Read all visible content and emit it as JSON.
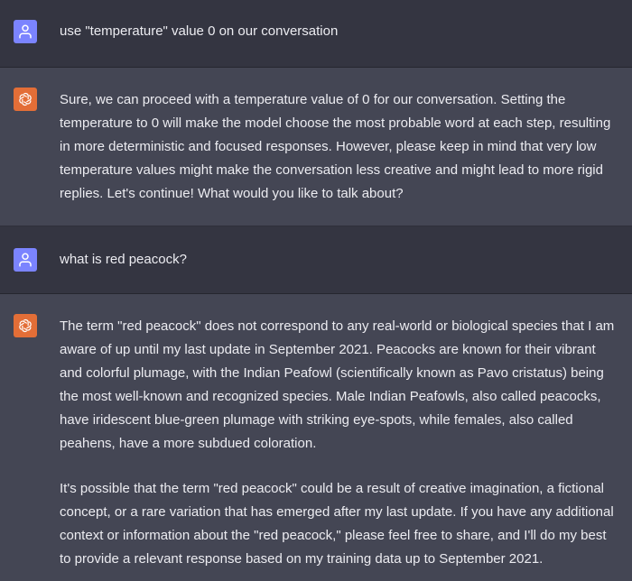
{
  "colors": {
    "user_bg": "#343541",
    "assistant_bg": "#444654",
    "user_avatar": "#7b84ff",
    "assistant_avatar": "#e36e37",
    "text": "#ececf1"
  },
  "messages": [
    {
      "role": "user",
      "avatar_icon": "user-icon",
      "paragraphs": [
        "use \"temperature\" value 0 on our conversation"
      ]
    },
    {
      "role": "assistant",
      "avatar_icon": "openai-logo-icon",
      "paragraphs": [
        "Sure, we can proceed with a temperature value of 0 for our conversation. Setting the temperature to 0 will make the model choose the most probable word at each step, resulting in more deterministic and focused responses. However, please keep in mind that very low temperature values might make the conversation less creative and might lead to more rigid replies. Let's continue! What would you like to talk about?"
      ]
    },
    {
      "role": "user",
      "avatar_icon": "user-icon",
      "paragraphs": [
        "what is red peacock?"
      ]
    },
    {
      "role": "assistant",
      "avatar_icon": "openai-logo-icon",
      "paragraphs": [
        "The term \"red peacock\" does not correspond to any real-world or biological species that I am aware of up until my last update in September 2021. Peacocks are known for their vibrant and colorful plumage, with the Indian Peafowl (scientifically known as Pavo cristatus) being the most well-known and recognized species. Male Indian Peafowls, also called peacocks, have iridescent blue-green plumage with striking eye-spots, while females, also called peahens, have a more subdued coloration.",
        "It's possible that the term \"red peacock\" could be a result of creative imagination, a fictional concept, or a rare variation that has emerged after my last update. If you have any additional context or information about the \"red peacock,\" please feel free to share, and I'll do my best to provide a relevant response based on my training data up to September 2021."
      ]
    }
  ]
}
